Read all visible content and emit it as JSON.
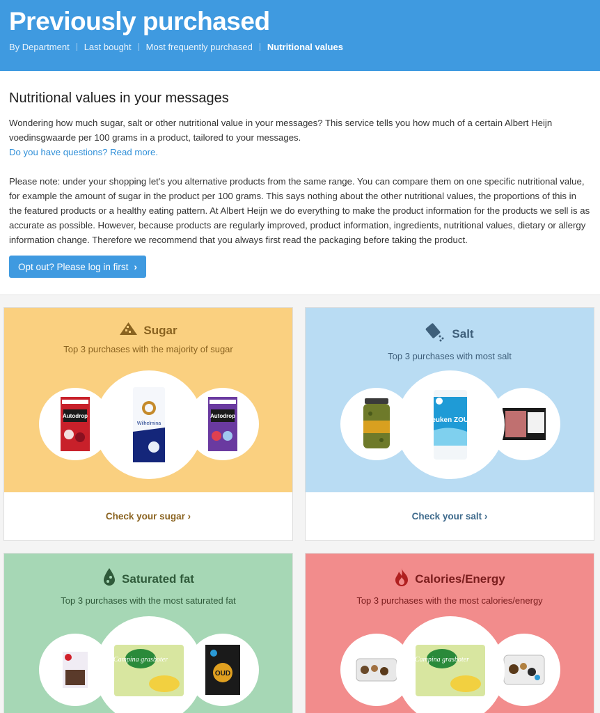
{
  "header": {
    "title": "Previously purchased",
    "nav": [
      "By Department",
      "Last bought",
      "Most frequently purchased",
      "Nutritional values"
    ],
    "active_nav": "Nutritional values"
  },
  "intro": {
    "heading": "Nutritional values in your messages",
    "paragraph": "Wondering how much sugar, salt or other nutritional value in your messages? This service tells you how much of a certain Albert Heijn voedinsgwaarde per 100 grams in a product, tailored to your messages.",
    "more_link": "Do you have questions? Read more.",
    "note": "Please note: under your shopping let's you alternative products from the same range. You can compare them on one specific nutritional value, for example the amount of sugar in the product per 100 grams. This says nothing about the other nutritional values, the proportions of this in the featured products or a healthy eating pattern. At Albert Heijn we do everything to make the product information for the products we sell is as accurate as possible. However, because products are regularly improved, product information, ingredients, nutritional values, dietary or allergy information change. Therefore we recommend that you always first read the packaging before taking the product.",
    "opt_out_button": "Opt out? Please log in first"
  },
  "cards": {
    "sugar": {
      "title": "Sugar",
      "subtitle": "Top 3 purchases with the majority of sugar",
      "link": "Check your sugar",
      "icon": "sugar-pile-icon",
      "color": "#fad080",
      "products": [
        "Autodrop",
        "Wilhelmina",
        "Autodrop"
      ]
    },
    "salt": {
      "title": "Salt",
      "subtitle": "Top 3 purchases with most salt",
      "link": "Check your salt",
      "icon": "salt-shaker-icon",
      "color": "#b9dcf3",
      "products": [
        "",
        "keuken ZOUT",
        ""
      ]
    },
    "fat": {
      "title": "Saturated fat",
      "subtitle": "Top 3 purchases with the most saturated fat",
      "icon": "fat-drop-icon",
      "color": "#a6d7b5",
      "products": [
        "",
        "Campina grasboter",
        "OUD"
      ]
    },
    "calories": {
      "title": "Calories/Energy",
      "subtitle": "Top 3 purchases with the most calories/energy",
      "icon": "flame-icon",
      "color": "#f28c8c",
      "products": [
        "",
        "Campina grasboter",
        ""
      ]
    }
  }
}
